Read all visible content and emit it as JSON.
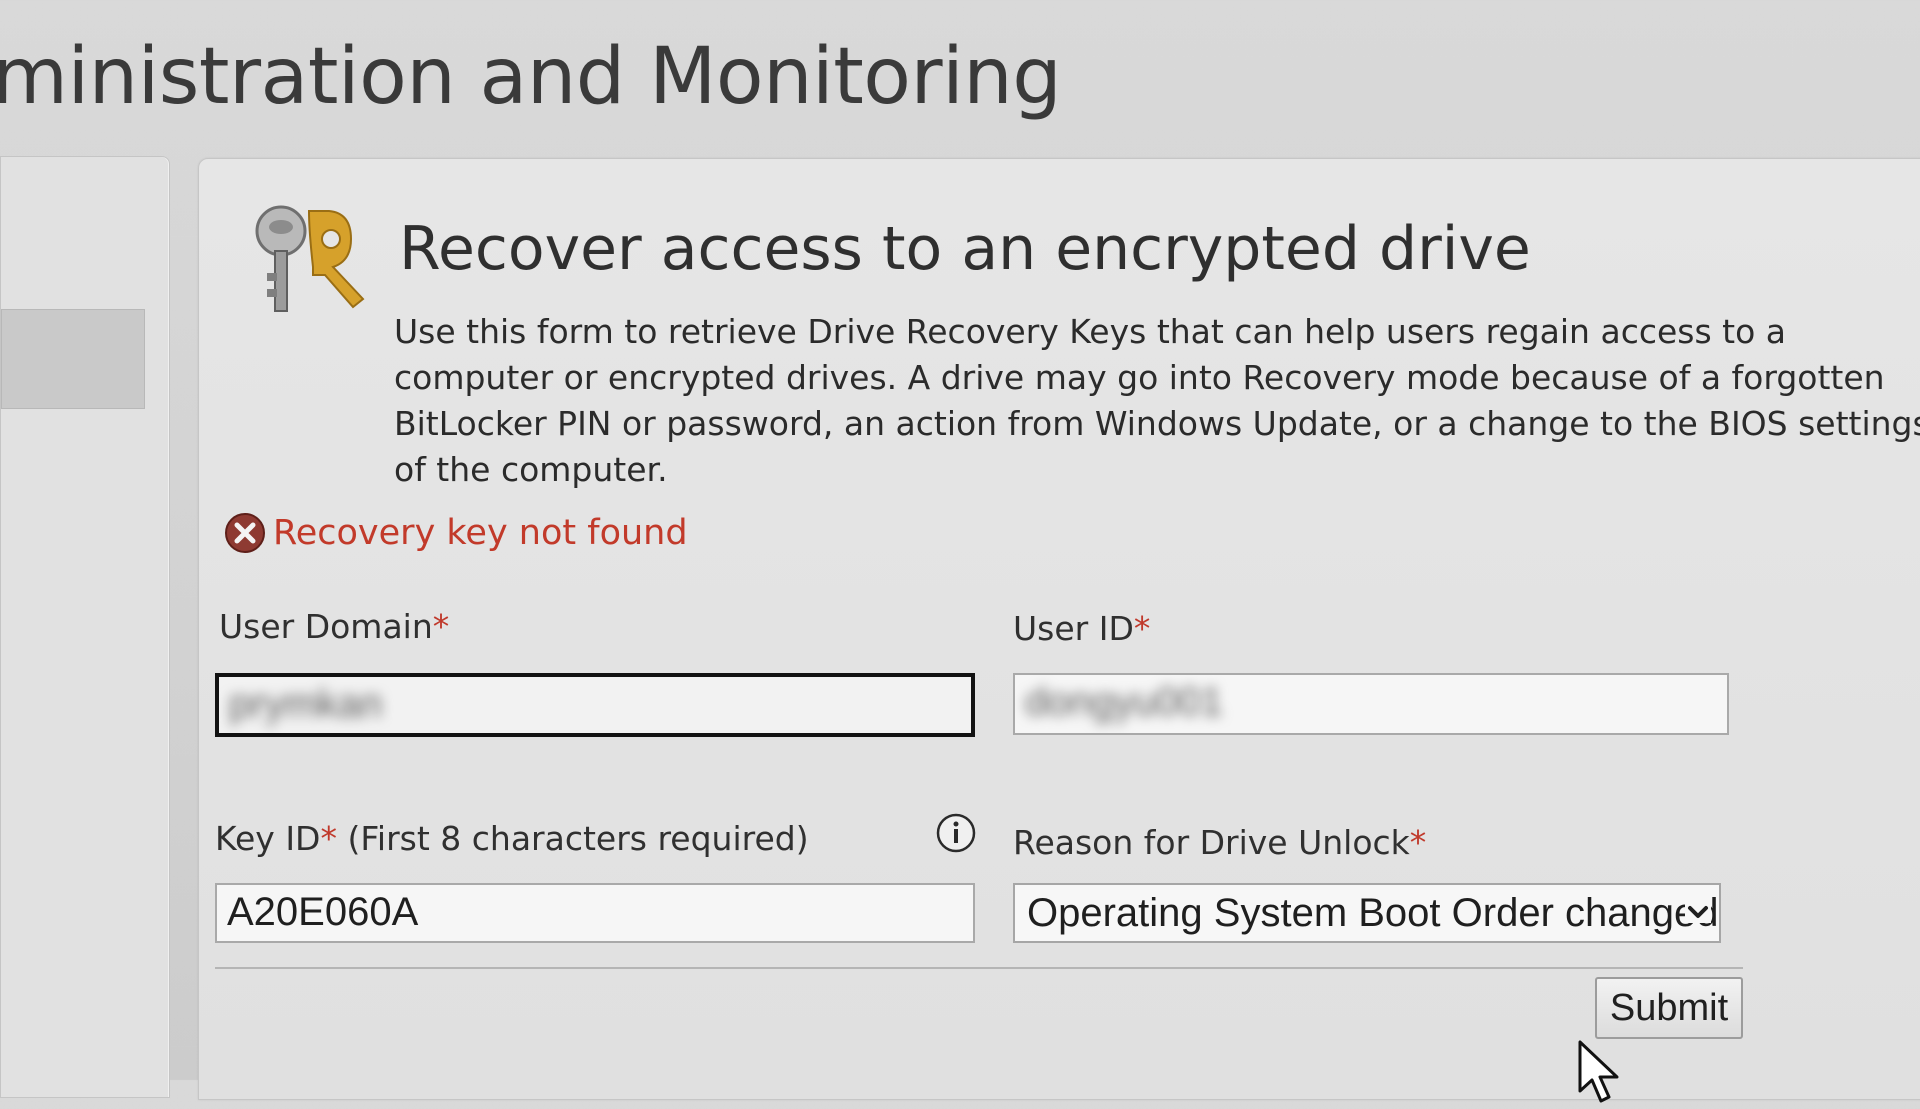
{
  "page": {
    "title": "ministration and Monitoring"
  },
  "form": {
    "heading": "Recover access to an encrypted drive",
    "description": "Use this form to retrieve Drive Recovery Keys that can help users regain access to a computer or encrypted drives. A drive may go into Recovery mode because of a forgotten BitLocker PIN or password, an action from Windows Update, or a change to the BIOS settings of the computer.",
    "error": "Recovery key not found",
    "user_domain": {
      "label": "User Domain",
      "required_mark": "*",
      "value": "prymkan"
    },
    "user_id": {
      "label": "User ID",
      "required_mark": "*",
      "value": "dongyu001"
    },
    "key_id": {
      "label": "Key ID",
      "required_mark": "*",
      "hint": " (First 8 characters required)",
      "value": "A20E060A"
    },
    "reason": {
      "label": "Reason for Drive Unlock",
      "required_mark": "*",
      "selected": "Operating System Boot Order changed"
    },
    "submit_label": "Submit"
  },
  "icons": {
    "key": "key-icon",
    "error": "error-x-icon",
    "info": "info-icon",
    "dropdown": "chevron-down-icon",
    "cursor": "mouse-pointer-icon"
  },
  "colors": {
    "error": "#c23a2a",
    "required": "#c0392b",
    "key_gold": "#d6a12b"
  }
}
